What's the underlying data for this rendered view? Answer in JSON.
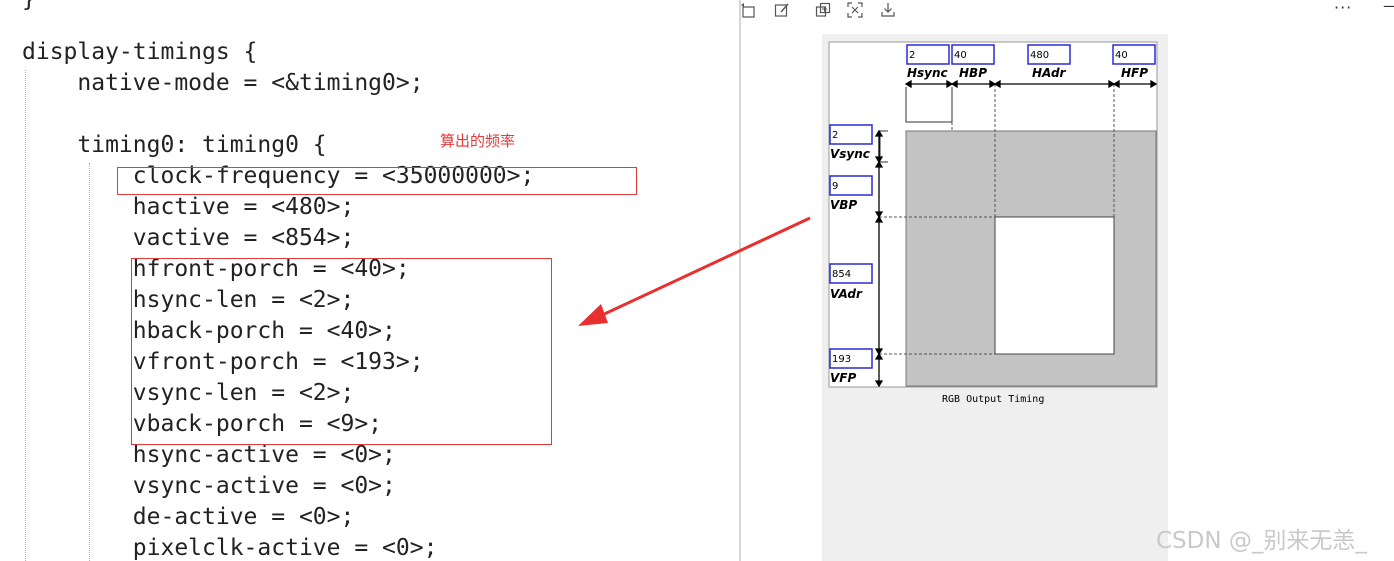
{
  "editor": {
    "top_brace": "}",
    "lines": [
      "display-timings {",
      "    native-mode = <&timing0>;",
      "",
      "    timing0: timing0 {",
      "        clock-frequency = <35000000>;",
      "        hactive = <480>;",
      "        vactive = <854>;",
      "        hfront-porch = <40>;",
      "        hsync-len = <2>;",
      "        hback-porch = <40>;",
      "        vfront-porch = <193>;",
      "        vsync-len = <2>;",
      "        vback-porch = <9>;",
      "        hsync-active = <0>;",
      "        vsync-active = <0>;",
      "        de-active = <0>;",
      "        pixelclk-active = <0>;"
    ],
    "annotation": "算出的频率",
    "highlight_color": "#e03a3a"
  },
  "toolbar": {
    "icons": [
      "rotate-icon",
      "edit-icon",
      "copy-icon",
      "fit-icon",
      "download-icon"
    ],
    "more_label": "···",
    "minimize_label": "—"
  },
  "diagram": {
    "caption": "RGB Output Timing",
    "horizontal": [
      {
        "label": "Hsync",
        "value": "2"
      },
      {
        "label": "HBP",
        "value": "40"
      },
      {
        "label": "HAdr",
        "value": "480"
      },
      {
        "label": "HFP",
        "value": "40"
      }
    ],
    "vertical": [
      {
        "label": "Vsync",
        "value": "2"
      },
      {
        "label": "VBP",
        "value": "9"
      },
      {
        "label": "VAdr",
        "value": "854"
      },
      {
        "label": "VFP",
        "value": "193"
      }
    ],
    "input_border_color": "#2a2ad6",
    "blanking_fill": "#c3c3c3"
  },
  "watermark": "CSDN @_别来无恙_"
}
